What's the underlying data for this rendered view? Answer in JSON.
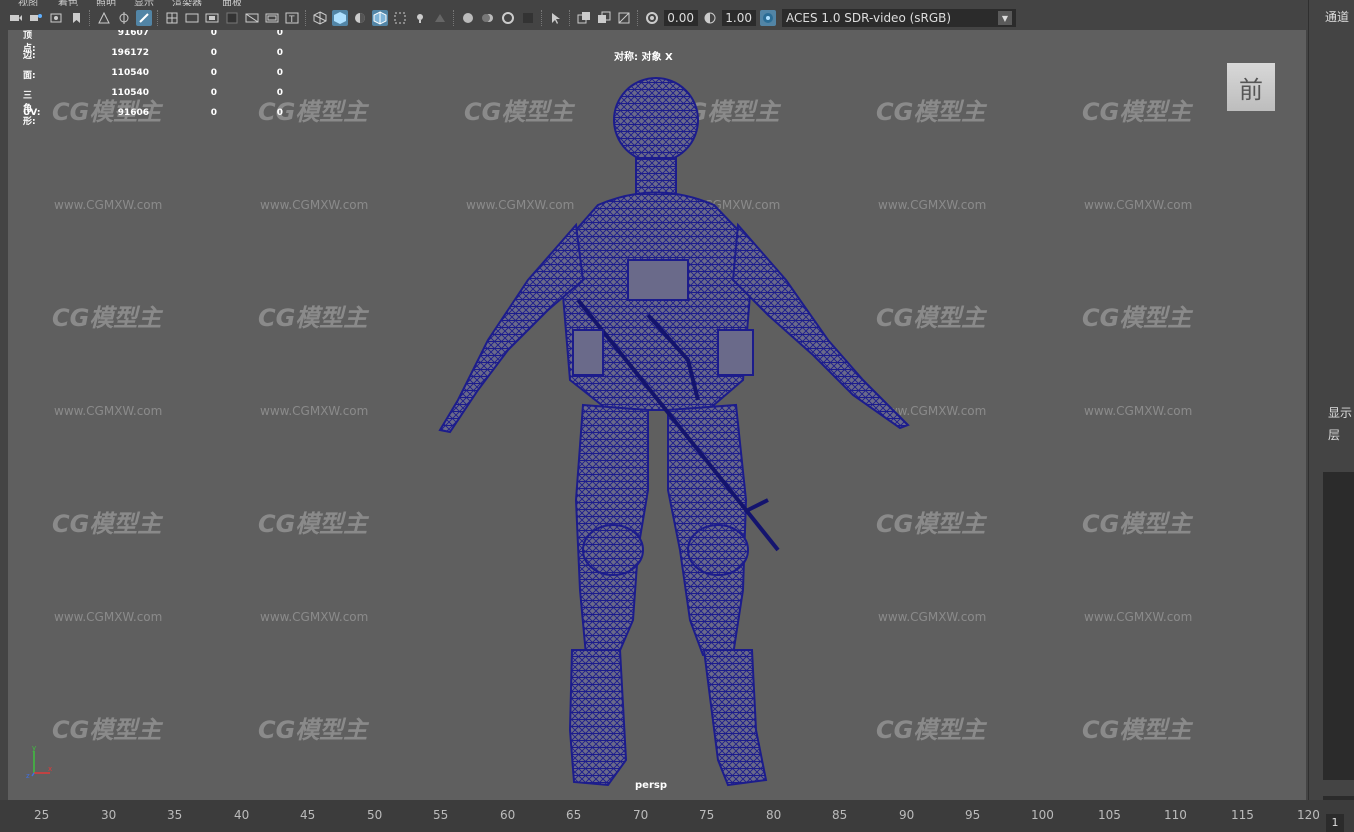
{
  "menu": [
    "视图",
    "着色",
    "照明",
    "显示",
    "渲染器",
    "面板"
  ],
  "toolbar": {
    "exposure": "0.00",
    "gamma": "1.00",
    "color_space": "ACES 1.0 SDR-video (sRGB)"
  },
  "hud": {
    "rows": [
      {
        "label": "顶点:",
        "v1": "91607",
        "v2": "0",
        "v3": "0"
      },
      {
        "label": "边:",
        "v1": "196172",
        "v2": "0",
        "v3": "0"
      },
      {
        "label": "面:",
        "v1": "110540",
        "v2": "0",
        "v3": "0"
      },
      {
        "label": "三角形:",
        "v1": "110540",
        "v2": "0",
        "v3": "0"
      },
      {
        "label": "UV:",
        "v1": "91606",
        "v2": "0",
        "v3": "0"
      }
    ],
    "symmetry": "对称: 对象 X",
    "camera": "persp"
  },
  "view_cube": "前",
  "axis": {
    "x": "x",
    "y": "y",
    "z": "z"
  },
  "watermark": {
    "logo": "CG模型主",
    "url": "www.CGMXW.com"
  },
  "right_panel": {
    "channels": "通道",
    "display": "显示",
    "layer": "层",
    "frame": "1"
  },
  "timeline": {
    "ticks": [
      "25",
      "30",
      "35",
      "40",
      "45",
      "50",
      "55",
      "60",
      "65",
      "70",
      "75",
      "80",
      "85",
      "90",
      "95",
      "100",
      "105",
      "110",
      "115",
      "120"
    ]
  },
  "colors": {
    "wireframe": "#1c1c8c",
    "viewport_bg": "#5f5f5f",
    "active_icon": "#5285a6"
  }
}
